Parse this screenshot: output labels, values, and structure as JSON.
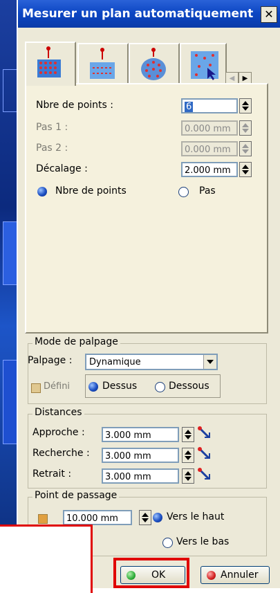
{
  "window": {
    "title": "Mesurer un plan automatiquement",
    "close_icon": "close-icon"
  },
  "tabs": {
    "items": [
      {
        "icon": "point-grid-icon",
        "active": true
      },
      {
        "icon": "scan-lines-icon",
        "active": false
      },
      {
        "icon": "cylinder-points-icon",
        "active": false
      },
      {
        "icon": "random-points-icon",
        "active": false
      }
    ],
    "scroll_left_icon": "chevron-left-icon",
    "scroll_right_icon": "chevron-right-icon"
  },
  "grid": {
    "nbre_points_label": "Nbre de points :",
    "nbre_points_value": "6",
    "pas1_label": "Pas 1 :",
    "pas1_value": "0.000 mm",
    "pas2_label": "Pas 2 :",
    "pas2_value": "0.000 mm",
    "decalage_label": "Décalage :",
    "decalage_value": "2.000 mm",
    "mode_option_1": "Nbre de points",
    "mode_option_2": "Pas"
  },
  "palpage": {
    "group_title": "Mode de palpage",
    "label": "Palpage :",
    "selected": "Dynamique",
    "defini_label": "Défini",
    "dessus_label": "Dessus",
    "dessous_label": "Dessous"
  },
  "distances": {
    "group_title": "Distances",
    "approche_label": "Approche :",
    "approche_value": "3.000 mm",
    "recherche_label": "Recherche :",
    "recherche_value": "3.000 mm",
    "retrait_label": "Retrait :",
    "retrait_value": "3.000 mm"
  },
  "passage": {
    "group_title": "Point de passage",
    "value": "10.000 mm",
    "haut_label": "Vers le haut",
    "bas_label": "Vers le bas"
  },
  "buttons": {
    "ok_label": "OK",
    "cancel_label": "Annuler"
  },
  "colors": {
    "title_bar": "#0b45c2",
    "ok_ball": "#2fae3a",
    "cancel_ball": "#d32020",
    "annotation": "#e00000"
  }
}
